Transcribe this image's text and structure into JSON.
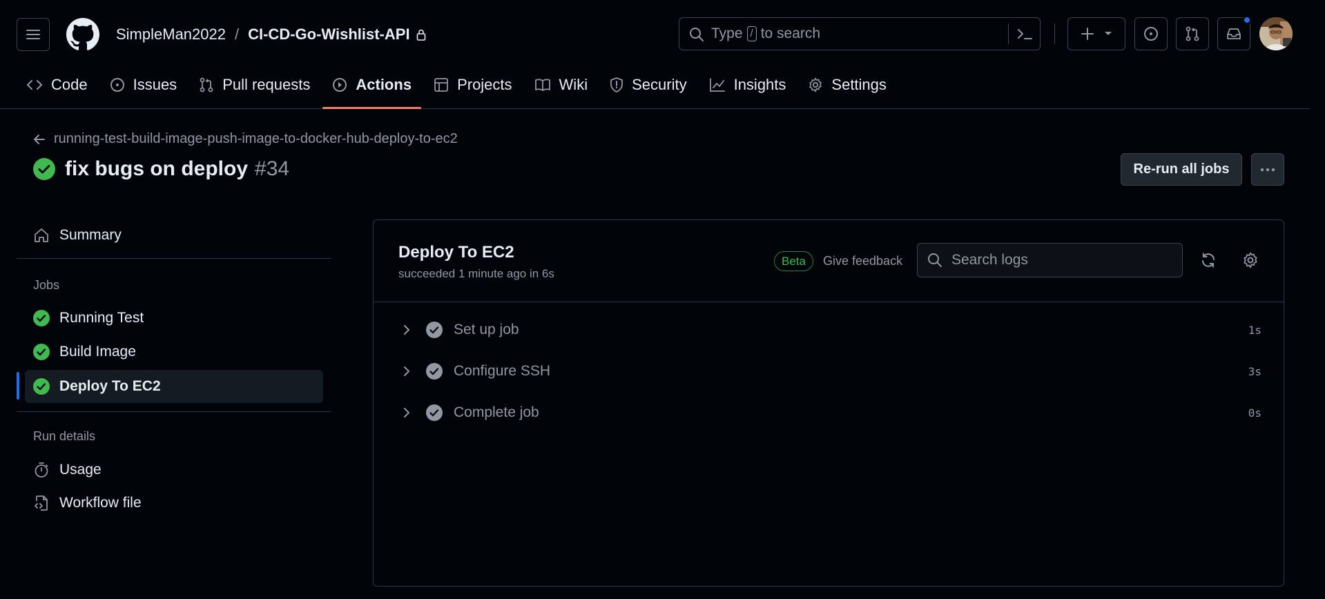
{
  "header": {
    "owner": "SimpleMan2022",
    "separator": "/",
    "repo": "CI-CD-Go-Wishlist-API",
    "search_prefix": "Type",
    "search_key": "/",
    "search_suffix": "to search"
  },
  "tabs": [
    {
      "label": "Code",
      "icon": "code-icon"
    },
    {
      "label": "Issues",
      "icon": "issue-icon"
    },
    {
      "label": "Pull requests",
      "icon": "pull-request-icon"
    },
    {
      "label": "Actions",
      "icon": "play-icon",
      "active": true
    },
    {
      "label": "Projects",
      "icon": "table-icon"
    },
    {
      "label": "Wiki",
      "icon": "book-icon"
    },
    {
      "label": "Security",
      "icon": "shield-icon"
    },
    {
      "label": "Insights",
      "icon": "graph-icon"
    },
    {
      "label": "Settings",
      "icon": "gear-icon"
    }
  ],
  "run": {
    "workflow_name": "running-test-build-image-push-image-to-docker-hub-deploy-to-ec2",
    "title": "fix bugs on deploy",
    "number": "#34",
    "rerun_label": "Re-run all jobs"
  },
  "sidebar": {
    "summary_label": "Summary",
    "jobs_heading": "Jobs",
    "jobs": [
      {
        "label": "Running Test",
        "status": "success"
      },
      {
        "label": "Build Image",
        "status": "success"
      },
      {
        "label": "Deploy To EC2",
        "status": "success",
        "selected": true
      }
    ],
    "run_details_heading": "Run details",
    "usage_label": "Usage",
    "workflow_file_label": "Workflow file"
  },
  "job": {
    "name": "Deploy To EC2",
    "status_text": "succeeded 1 minute ago in 6s",
    "beta_label": "Beta",
    "feedback_label": "Give feedback",
    "search_placeholder": "Search logs",
    "steps": [
      {
        "name": "Set up job",
        "duration": "1s"
      },
      {
        "name": "Configure SSH",
        "duration": "3s"
      },
      {
        "name": "Complete job",
        "duration": "0s"
      }
    ]
  },
  "colors": {
    "success": "#3fb950",
    "step_check": "#9198a1",
    "accent_tab": "#f78166",
    "selection_bar": "#1f6feb",
    "notification_dot": "#1f6feb"
  }
}
